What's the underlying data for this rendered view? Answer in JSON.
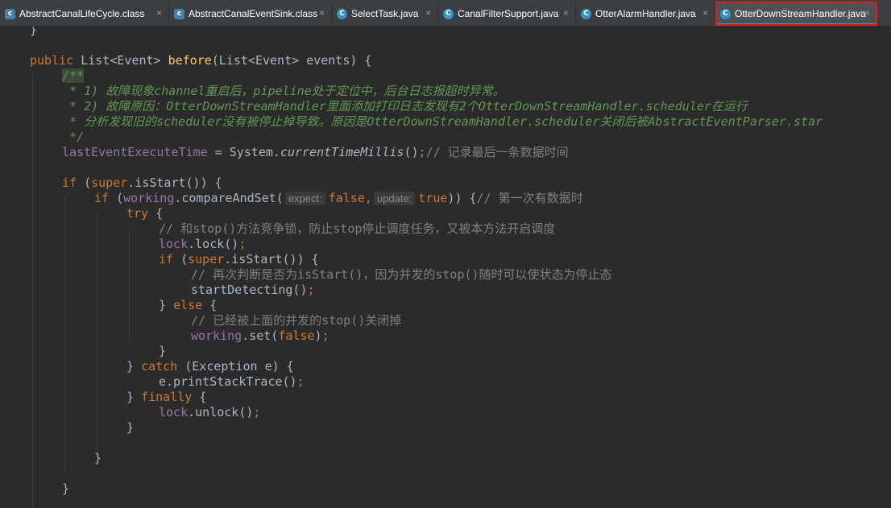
{
  "tabs": [
    {
      "label": "AbstractCanalLifeCycle.class",
      "icon": "class-icon",
      "icon_glyph": "c",
      "active": false
    },
    {
      "label": "AbstractCanalEventSink.class",
      "icon": "class-icon",
      "icon_glyph": "c",
      "active": false
    },
    {
      "label": "SelectTask.java",
      "icon": "java-class-icon",
      "icon_glyph": "C",
      "active": false
    },
    {
      "label": "CanalFilterSupport.java",
      "icon": "java-class-icon",
      "icon_glyph": "C",
      "active": false
    },
    {
      "label": "OtterAlarmHandler.java",
      "icon": "java-class-icon",
      "icon_glyph": "C",
      "active": false
    },
    {
      "label": "OtterDownStreamHandler.java",
      "icon": "java-class-icon",
      "icon_glyph": "C",
      "active": true
    }
  ],
  "close_glyph": "×",
  "code": {
    "l1_brace": "}",
    "l2_public": "public ",
    "l2_type": "List<Event> ",
    "l2_method": "before",
    "l2_params": "(List<Event> events) {",
    "doc_open": "/**",
    "doc1_a": " * 1) 故障现象",
    "doc1_b": "channel",
    "doc1_c": "重启后，",
    "doc1_d": "pipeline",
    "doc1_e": "处于定位中，后台日志报超时异常。",
    "doc2_a": " * 2) 故障原因：",
    "doc2_b": "OtterDownStreamHandler",
    "doc2_c": "里面添加打印日志发现有2个",
    "doc2_d": "OtterDownStreamHandler.scheduler",
    "doc2_e": "在运行",
    "doc3_a": " * 分析发现旧的",
    "doc3_b": "scheduler",
    "doc3_c": "没有被停止掉导致。原因是",
    "doc3_d": "OtterDownStreamHandler.scheduler",
    "doc3_e": "关闭后被",
    "doc3_f": "AbstractEventParser.star",
    "doc_close": " */",
    "l8_field": "lastEventExecuteTime",
    "l8_eq": " = System.",
    "l8_call": "currentTimeMillis",
    "l8_paren": "()",
    "l8_semi": ";",
    "l8_cmt": "// 记录最后一条数据时间",
    "l10_if": "if ",
    "l10_paren": "(",
    "l10_super": "super",
    "l10_rest": ".isStart()) {",
    "l11_if": "if ",
    "l11_paren": "(",
    "l11_working": "working",
    "l11_call": ".compareAndSet(",
    "l11_hint1": "expect:",
    "l11_false": "false",
    "l11_comma": ",",
    "l11_hint2": "update:",
    "l11_true": "true",
    "l11_close": ")) {",
    "l11_cmt": "// 第一次有数据时",
    "l12_try": "try ",
    "l12_brace": "{",
    "l13_cmt": "// 和stop()方法竞争锁，防止stop停止调度任务，又被本方法开启调度",
    "l14_lock": "lock",
    "l14_call": ".lock()",
    "l14_semi": ";",
    "l15_if": "if ",
    "l15_paren": "(",
    "l15_super": "super",
    "l15_rest": ".isStart()) {",
    "l16_cmt": "// 再次判断是否为isStart()，因为并发的stop()随时可以使状态为停止态",
    "l17_call": "startDetecting()",
    "l17_semi": ";",
    "l18_brace": "} ",
    "l18_else": "else ",
    "l18_open": "{",
    "l19_cmt": "// 已经被上面的并发的stop()关闭掉",
    "l20_working": "working",
    "l20_call": ".set(",
    "l20_false": "false",
    "l20_close": ")",
    "l20_semi": ";",
    "l21_brace": "}",
    "l22_brace": "} ",
    "l22_catch": "catch ",
    "l22_rest": "(Exception e) {",
    "l23_call": "e.printStackTrace()",
    "l23_semi": ";",
    "l24_brace": "} ",
    "l24_finally": "finally ",
    "l24_open": "{",
    "l25_lock": "lock",
    "l25_call": ".unlock()",
    "l25_semi": ";",
    "l26_brace": "}",
    "l28_brace": "}",
    "l30_brace": "}"
  },
  "colors": {
    "background": "#2b2b2b",
    "keyword": "#cc7832",
    "method": "#ffc66d",
    "field": "#9876aa",
    "doc_comment": "#629755",
    "comment": "#808080",
    "highlight_box": "#e0201a"
  }
}
